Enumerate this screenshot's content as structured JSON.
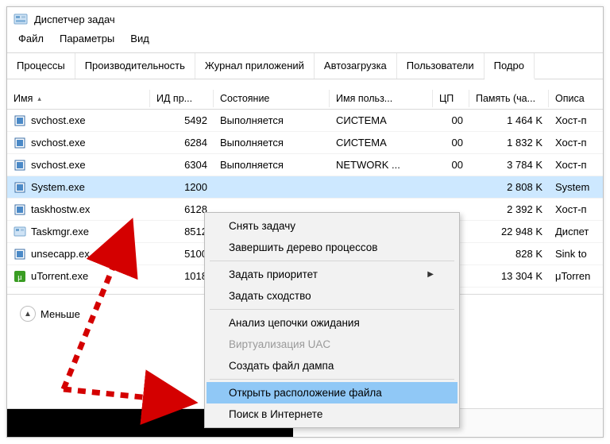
{
  "window": {
    "title": "Диспетчер задач"
  },
  "menu": {
    "file": "Файл",
    "options": "Параметры",
    "view": "Вид"
  },
  "tabs": {
    "processes": "Процессы",
    "performance": "Производительность",
    "app_history": "Журнал приложений",
    "startup": "Автозагрузка",
    "users": "Пользователи",
    "details": "Подро"
  },
  "columns": {
    "name": "Имя",
    "pid": "ИД пр...",
    "status": "Состояние",
    "user": "Имя польз...",
    "cpu": "ЦП",
    "memory": "Память (ча...",
    "desc": "Описа"
  },
  "rows": [
    {
      "name": "svchost.exe",
      "icon": "svc",
      "pid": "5492",
      "status": "Выполняется",
      "user": "СИСТЕМА",
      "cpu": "00",
      "mem": "1 464 K",
      "desc": "Хост-п"
    },
    {
      "name": "svchost.exe",
      "icon": "svc",
      "pid": "6284",
      "status": "Выполняется",
      "user": "СИСТЕМА",
      "cpu": "00",
      "mem": "1 832 K",
      "desc": "Хост-п"
    },
    {
      "name": "svchost.exe",
      "icon": "svc",
      "pid": "6304",
      "status": "Выполняется",
      "user": "NETWORK ...",
      "cpu": "00",
      "mem": "3 784 K",
      "desc": "Хост-п"
    },
    {
      "name": "System.exe",
      "icon": "svc",
      "pid": "1200",
      "status": "",
      "user": "",
      "cpu": "",
      "mem": "2 808 K",
      "desc": "System"
    },
    {
      "name": "taskhostw.ex",
      "icon": "svc",
      "pid": "6128",
      "status": "",
      "user": "",
      "cpu": "",
      "mem": "2 392 K",
      "desc": "Хост-п"
    },
    {
      "name": "Taskmgr.exe",
      "icon": "tm",
      "pid": "8512",
      "status": "",
      "user": "",
      "cpu": "",
      "mem": "22 948 K",
      "desc": "Диспет"
    },
    {
      "name": "unsecapp.ex",
      "icon": "svc",
      "pid": "5100",
      "status": "",
      "user": "",
      "cpu": "",
      "mem": "828 K",
      "desc": "Sink to"
    },
    {
      "name": "uTorrent.exe",
      "icon": "ut",
      "pid": "1018",
      "status": "",
      "user": "",
      "cpu": "",
      "mem": "13 304 K",
      "desc": "μTorren"
    }
  ],
  "selected_row_index": 3,
  "footer": {
    "less_label": "Меньше"
  },
  "context_menu": {
    "end_task": "Снять задачу",
    "end_tree": "Завершить дерево процессов",
    "set_priority": "Задать приоритет",
    "set_affinity": "Задать сходство",
    "analyze_wait": "Анализ цепочки ожидания",
    "uac_virt": "Виртуализация UAC",
    "create_dump": "Создать файл дампа",
    "open_location": "Открыть расположение файла",
    "search_online": "Поиск в Интернете"
  }
}
